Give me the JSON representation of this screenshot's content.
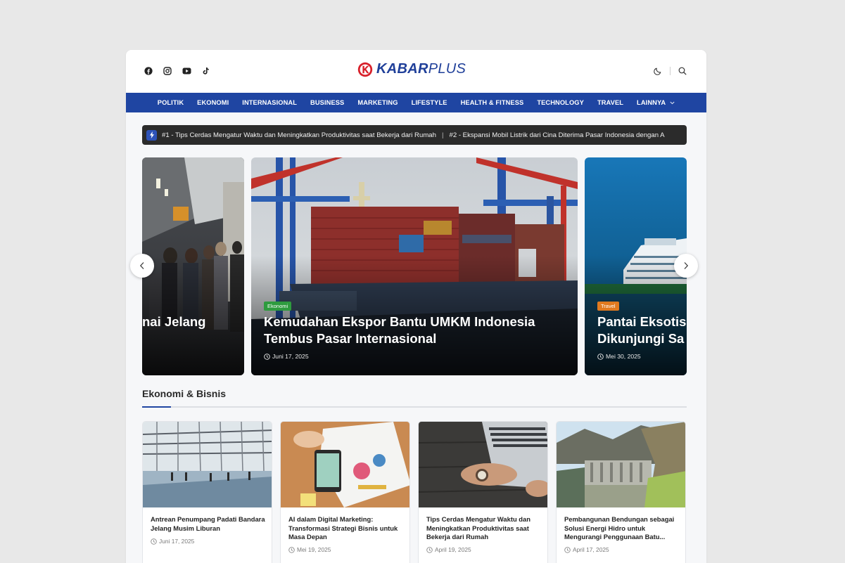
{
  "header": {
    "logo_main": "KABAR",
    "logo_plus": "PLUS",
    "socials": [
      "facebook-icon",
      "instagram-icon",
      "youtube-icon",
      "tiktok-icon"
    ],
    "tools": [
      "moon-icon",
      "search-icon"
    ]
  },
  "nav": {
    "items": [
      "POLITIK",
      "EKONOMI",
      "INTERNASIONAL",
      "BUSINESS",
      "MARKETING",
      "LIFESTYLE",
      "HEALTH & FITNESS",
      "TECHNOLOGY",
      "TRAVEL",
      "LAINNYA"
    ]
  },
  "ticker": {
    "item1": "#1 - Tips Cerdas Mengatur Waktu dan Meningkatkan Produktivitas saat Bekerja dari Rumah",
    "divider": "|",
    "item2": "#2 - Ekspansi Mobil Listrik dari Cina Diterima Pasar Indonesia dengan A"
  },
  "slider": {
    "left": {
      "title": "nai Jelang"
    },
    "center": {
      "category": "Ekonomi",
      "category_color": "#2e9b3e",
      "title_line1": "Kemudahan Ekspor Bantu UMKM Indonesia",
      "title_line2": "Tembus Pasar Internasional",
      "date": "Juni 17, 2025"
    },
    "right": {
      "category": "Travel",
      "category_color": "#e07a1f",
      "title_line1": "Pantai Eksotis",
      "title_line2": "Dikunjungi Sa",
      "date": "Mei 30, 2025"
    }
  },
  "section": {
    "title": "Ekonomi & Bisnis",
    "accent": "#1f45a2",
    "cards": [
      {
        "title": "Antrean Penumpang Padati Bandara Jelang Musim Liburan",
        "date": "Juni 17, 2025"
      },
      {
        "title": "AI dalam Digital Marketing: Transformasi Strategi Bisnis untuk Masa Depan",
        "date": "Mei 19, 2025"
      },
      {
        "title": "Tips Cerdas Mengatur Waktu dan Meningkatkan Produktivitas saat Bekerja dari Rumah",
        "date": "April 19, 2025"
      },
      {
        "title": "Pembangunan Bendungan sebagai Solusi Energi Hidro untuk Mengurangi Penggunaan Batu...",
        "date": "April 17, 2025"
      }
    ]
  }
}
